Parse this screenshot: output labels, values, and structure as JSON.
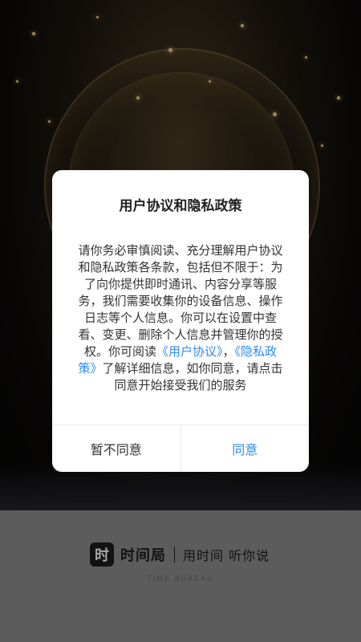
{
  "dialog": {
    "title": "用户协议和隐私政策",
    "body_part1": "请你务必审慎阅读、充分理解用户协议和隐私政策各条款，包括但不限于：为了向你提供即时通讯、内容分享等服务，我们需要收集你的设备信息、操作日志等个人信息。你可以在设置中查看、变更、删除个人信息并管理你的授权。你可阅读",
    "link_user_agreement": "《用户协议》",
    "comma": "，",
    "link_privacy_policy": "《隐私政策》",
    "body_part2": "了解详细信息，如你同意，请点击同意开始接受我们的服务",
    "decline_label": "暂不同意",
    "agree_label": "同意"
  },
  "brand": {
    "logo_char": "时",
    "name": "时间局",
    "slogan": "用时间 听你说",
    "english": "TIME BUREAU"
  },
  "colors": {
    "link": "#2f8cf0",
    "footer_bg": "#8e8e8e"
  }
}
